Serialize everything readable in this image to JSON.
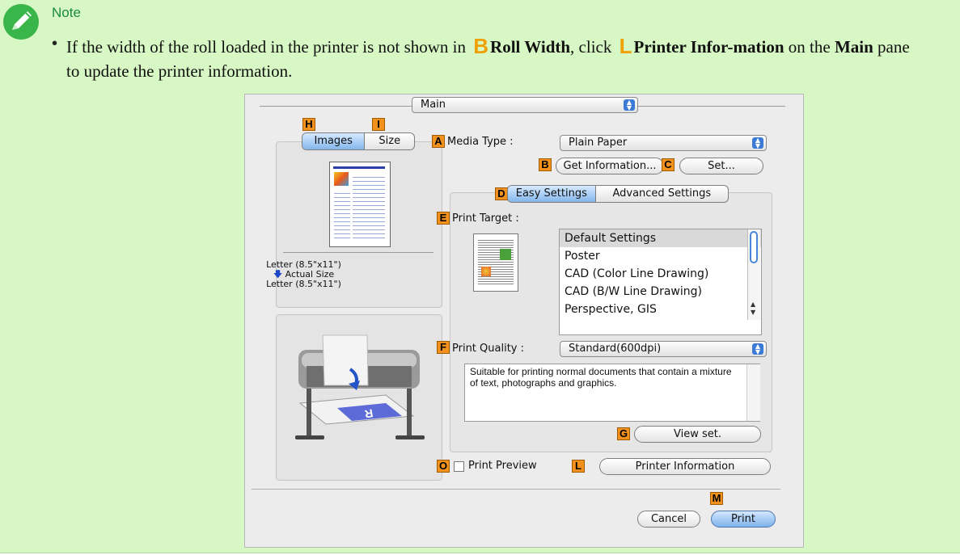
{
  "note": {
    "title": "Note",
    "bullet": "•",
    "text_1": "If the width of the roll loaded in the printer is not shown in",
    "key_b": "B",
    "roll_width": "Roll Width",
    "text_2": ", click",
    "key_l": "L",
    "printer_info": "Printer Infor-mation",
    "text_3": "on the",
    "main": "Main",
    "text_4": "pane to update the printer information."
  },
  "dialog": {
    "pane_popup": "Main",
    "tab_images": "Images",
    "tab_size": "Size",
    "media_type_label": "Media Type :",
    "media_type_value": "Plain Paper",
    "get_information": "Get Information...",
    "set": "Set...",
    "tab_easy": "Easy Settings",
    "tab_advanced": "Advanced Settings",
    "print_target_label": "Print Target :",
    "print_targets": [
      "Default Settings",
      "Poster",
      "CAD (Color Line Drawing)",
      "CAD (B/W Line Drawing)",
      "Perspective, GIS"
    ],
    "paper_from": "Letter (8.5\"x11\")",
    "actual_size": "Actual Size",
    "paper_to": "Letter (8.5\"x11\")",
    "print_quality_label": "Print Quality :",
    "print_quality_value": "Standard(600dpi)",
    "quality_desc": "Suitable for printing normal documents that contain a mixture of text, photographs and graphics.",
    "view_set": "View set.",
    "print_preview": "Print Preview",
    "printer_information": "Printer Information",
    "cancel": "Cancel",
    "print": "Print",
    "markers": {
      "A": "A",
      "B": "B",
      "C": "C",
      "D": "D",
      "E": "E",
      "F": "F",
      "G": "G",
      "H": "H",
      "I": "I",
      "L": "L",
      "M": "M",
      "O": "O"
    }
  },
  "colors": {
    "note_bg": "#d7f7c4",
    "note_title": "#1a8a3f",
    "marker_key": "#f0a000",
    "label_box": "#f2911e"
  }
}
